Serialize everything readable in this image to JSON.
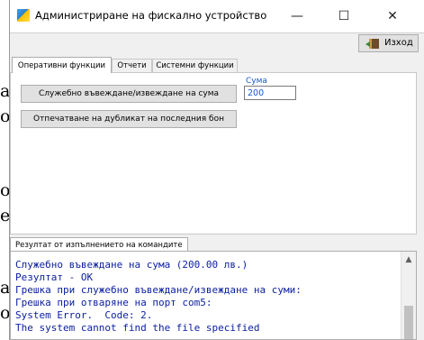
{
  "background_fragments": [
    "а",
    "о",
    "о",
    "е",
    "а",
    "о"
  ],
  "window": {
    "title": "Администриране на фискално устройство",
    "controls": {
      "minimize": "—",
      "maximize": "☐",
      "close": "✕"
    }
  },
  "toolbar": {
    "exit_label": "Изход",
    "exit_icon": "door-exit-icon"
  },
  "tabs": [
    {
      "label": "Оперативни функции",
      "active": true
    },
    {
      "label": "Отчети",
      "active": false
    },
    {
      "label": "Системни функции",
      "active": false
    }
  ],
  "operations": {
    "cash_in_out_button": "Служебно въвеждане/извеждане на сума",
    "print_duplicate_button": "Отпечатване на дубликат на последния бон",
    "amount_label": "Сума",
    "amount_value": "200"
  },
  "result": {
    "tab_label": "Резултат от изпълнението на командите",
    "lines": [
      "Служебно въвеждане на сума (200.00 лв.)",
      "Резултат - OK",
      "Грешка при служебно въвеждане/извеждане на суми:",
      "Грешка при отваряне на порт com5:",
      "System Error.  Code: 2.",
      "The system cannot find the file specified"
    ]
  },
  "colors": {
    "accent_text": "#0a1e9e",
    "amount_text": "#1a57c9"
  }
}
